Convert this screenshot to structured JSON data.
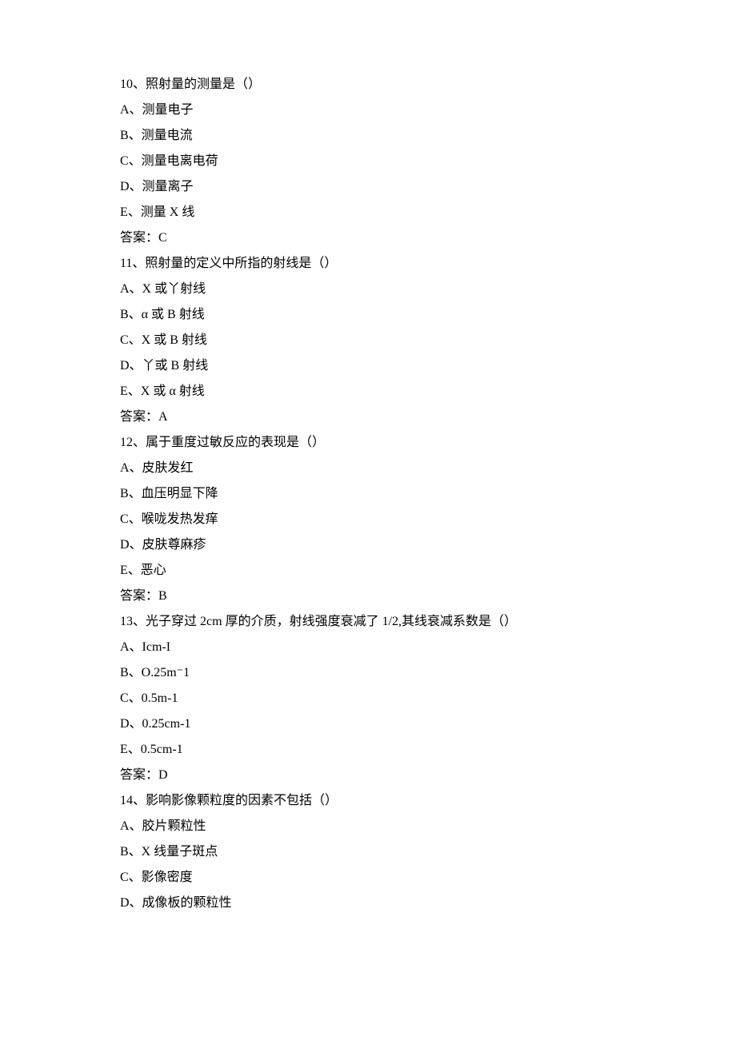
{
  "questions": [
    {
      "number": "10、",
      "stem": "照射量的测量是（）",
      "options": [
        "A、测量电子",
        "B、测量电流",
        "C、测量电离电荷",
        "D、测量离子",
        "E、测量 X 线"
      ],
      "answer": "答案：C"
    },
    {
      "number": "11、",
      "stem": "照射量的定义中所指的射线是（）",
      "options": [
        "A、X 或丫射线",
        "B、α 或 B 射线",
        "C、X 或 B 射线",
        "D、丫或 B 射线",
        "E、X 或 α 射线"
      ],
      "answer": "答案：A"
    },
    {
      "number": "12、",
      "stem": "属于重度过敏反应的表现是（）",
      "options": [
        "A、皮肤发红",
        "B、血压明显下降",
        "C、喉咙发热发痒",
        "D、皮肤尊麻疹",
        "E、恶心"
      ],
      "answer": "答案：B"
    },
    {
      "number": "13、",
      "stem": "光子穿过 2cm 厚的介质，射线强度衰减了 1/2,其线衰减系数是（）",
      "options": [
        "A、Icm-I",
        "B、O.25m⁻1",
        "C、0.5m-1",
        "D、0.25cm-1",
        "E、0.5cm-1"
      ],
      "answer": "答案：D"
    },
    {
      "number": "14、",
      "stem": "影响影像颗粒度的因素不包括（）",
      "options": [
        "A、胶片颗粒性",
        "B、X 线量子斑点",
        "C、影像密度",
        "D、成像板的颗粒性"
      ],
      "answer": null
    }
  ]
}
